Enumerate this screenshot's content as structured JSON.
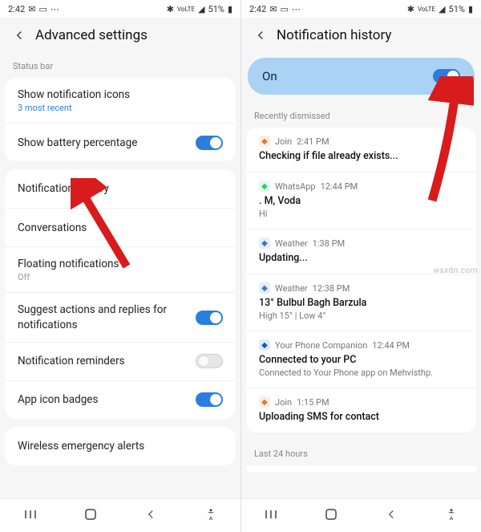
{
  "statusbar": {
    "time": "2:42",
    "battery": "51%",
    "lte": "VoLTE"
  },
  "left": {
    "title": "Advanced settings",
    "status_bar_label": "Status bar",
    "items": {
      "show_icons": {
        "title": "Show notification icons",
        "sub": "3 most recent"
      },
      "battery_pct": {
        "title": "Show battery percentage"
      },
      "notif_history": {
        "title": "Notification history"
      },
      "conversations": {
        "title": "Conversations"
      },
      "floating": {
        "title": "Floating notifications",
        "sub": "Off"
      },
      "suggest": {
        "title": "Suggest actions and replies for notifications"
      },
      "reminders": {
        "title": "Notification reminders"
      },
      "badges": {
        "title": "App icon badges"
      },
      "wireless": {
        "title": "Wireless emergency alerts"
      }
    }
  },
  "right": {
    "title": "Notification history",
    "on_label": "On",
    "recently_label": "Recently dismissed",
    "last24_label": "Last 24 hours",
    "notifs": [
      {
        "app": "Join",
        "time": "2:41 PM",
        "title": "Checking if file already exists...",
        "body": "",
        "icon_color": "#e07b2e"
      },
      {
        "app": "WhatsApp",
        "time": "12:44 PM",
        "title": ". M, Voda",
        "body": "Hi",
        "icon_color": "#25d366"
      },
      {
        "app": "Weather",
        "time": "1:38 PM",
        "title": "Updating...",
        "body": "",
        "icon_color": "#3a78c4"
      },
      {
        "app": "Weather",
        "time": "12:38 PM",
        "title": "13° Bulbul Bagh Barzula",
        "body": "High 15° | Low 4°",
        "icon_color": "#3a78c4"
      },
      {
        "app": "Your Phone Companion",
        "time": "12:44 PM",
        "title": "Connected to your PC",
        "body": "Connected to Your Phone app on Mehvisthp.",
        "icon_color": "#0a5fc4"
      },
      {
        "app": "Join",
        "time": "1:15 PM",
        "title": "Uploading SMS for contact",
        "body": "",
        "icon_color": "#e07b2e"
      }
    ]
  },
  "watermark": "wsxdn.com"
}
